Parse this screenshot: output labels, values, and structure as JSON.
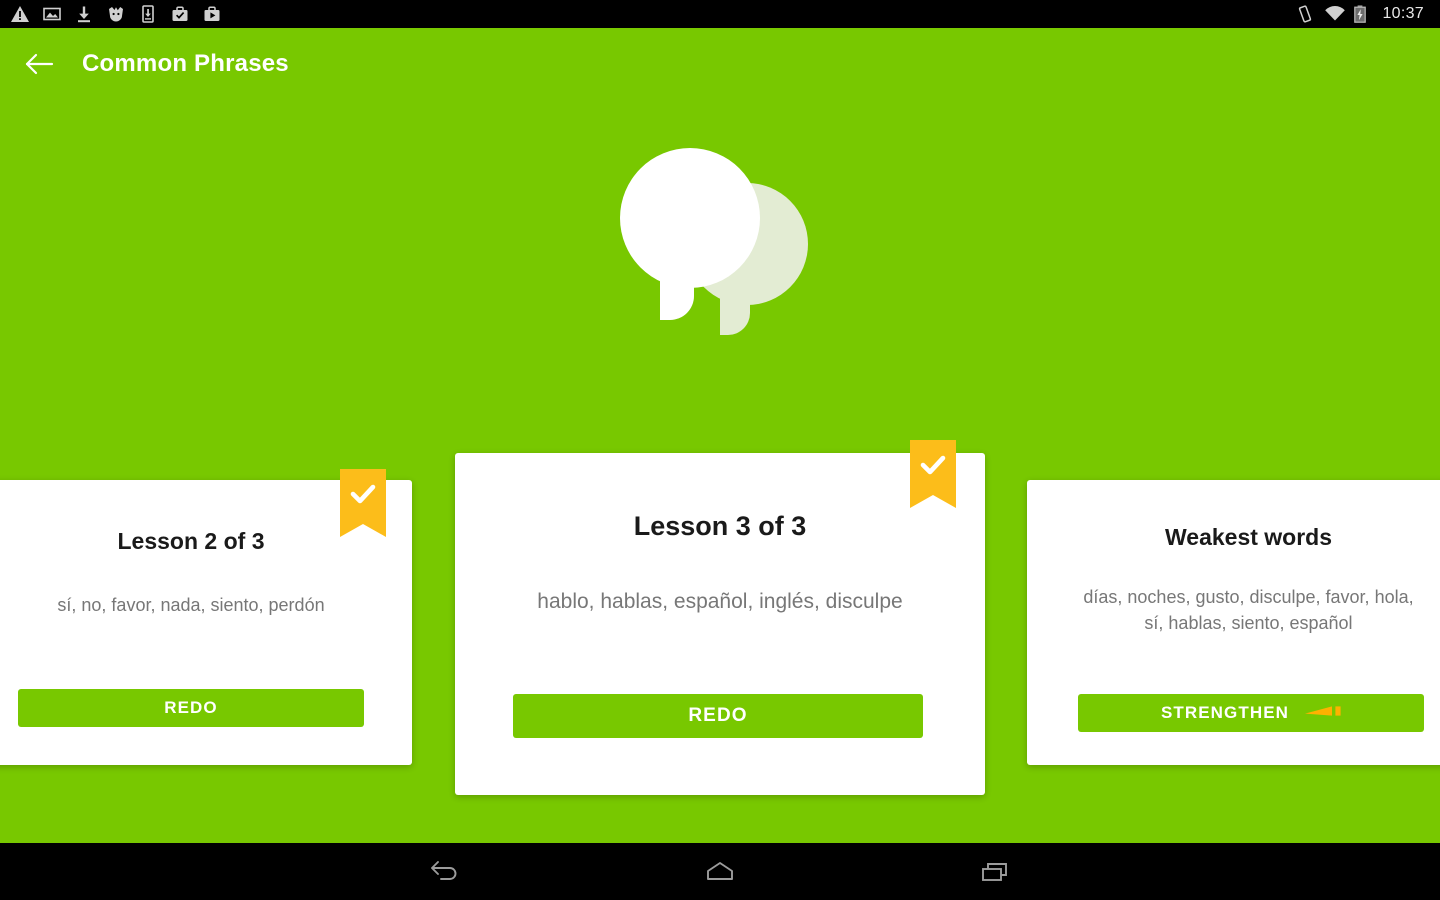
{
  "status_bar": {
    "time": "10:37",
    "left_icons": [
      {
        "name": "warning-icon",
        "label": "warning"
      },
      {
        "name": "image-icon",
        "label": "screenshot"
      },
      {
        "name": "download-icon",
        "label": "download"
      },
      {
        "name": "bird-icon",
        "label": "app-notification"
      },
      {
        "name": "install-icon",
        "label": "app-install"
      },
      {
        "name": "briefcase-check-icon",
        "label": "work-check"
      },
      {
        "name": "briefcase-play-icon",
        "label": "store"
      }
    ],
    "right_icons": [
      {
        "name": "vibrate-icon",
        "label": "vibrate"
      },
      {
        "name": "wifi-icon",
        "label": "wifi"
      },
      {
        "name": "battery-charging-icon",
        "label": "battery charging"
      }
    ]
  },
  "toolbar": {
    "back_label": "Back",
    "title": "Common Phrases"
  },
  "hero": {
    "icon_name": "speech-bubbles-icon",
    "front_color": "#ffffff",
    "back_color": "#e3ecd3"
  },
  "theme": {
    "green": "#78c800",
    "ribbon_yellow": "#fcbd1a",
    "strength_orange": "#ffb100",
    "card_white": "#ffffff",
    "title_color": "#1a1a1a",
    "words_color": "#777777"
  },
  "cards": [
    {
      "id": "lesson-2",
      "title": "Lesson 2 of 3",
      "words": "sí, no, favor, nada, siento, perdón",
      "button_label": "REDO",
      "completed": true,
      "has_strength_icon": false
    },
    {
      "id": "lesson-3",
      "title": "Lesson 3 of 3",
      "words": "hablo, hablas, español, inglés, disculpe",
      "button_label": "REDO",
      "completed": true,
      "has_strength_icon": false
    },
    {
      "id": "weakest-words",
      "title": "Weakest words",
      "words": "días, noches, gusto, disculpe, favor, hola, sí, hablas, siento, español",
      "button_label": "STRENGTHEN",
      "completed": false,
      "has_strength_icon": true
    }
  ],
  "nav_bar": {
    "buttons": [
      {
        "name": "nav-back-button",
        "label": "Back"
      },
      {
        "name": "nav-home-button",
        "label": "Home"
      },
      {
        "name": "nav-recents-button",
        "label": "Recent apps"
      }
    ]
  }
}
